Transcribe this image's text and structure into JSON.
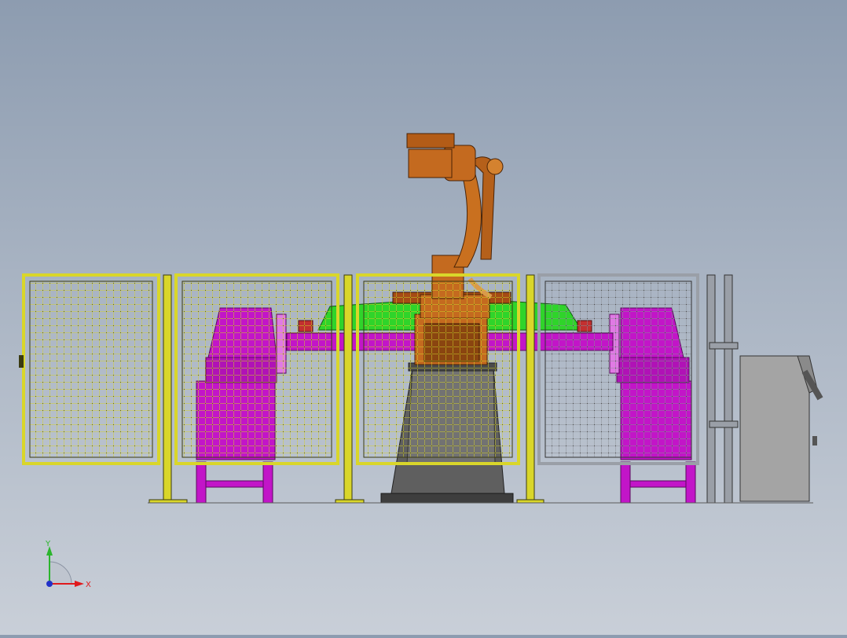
{
  "viewport": {
    "background_top": "#8d9cb0",
    "background_bottom": "#c9cfd8"
  },
  "colors": {
    "fence_yellow": "#d9d62a",
    "fence_gray": "#9a9fa7",
    "magenta": "#c215c8",
    "green": "#2fd42a",
    "robot_orange": "#c46a1f",
    "pedestal": "#6d6d6d",
    "control_cabinet": "#a4a4a4"
  },
  "triad": {
    "y_label": "Y",
    "x_label": "X",
    "x_color": "#e0191c",
    "y_color": "#2bb52d",
    "z_color": "#2231c8"
  }
}
